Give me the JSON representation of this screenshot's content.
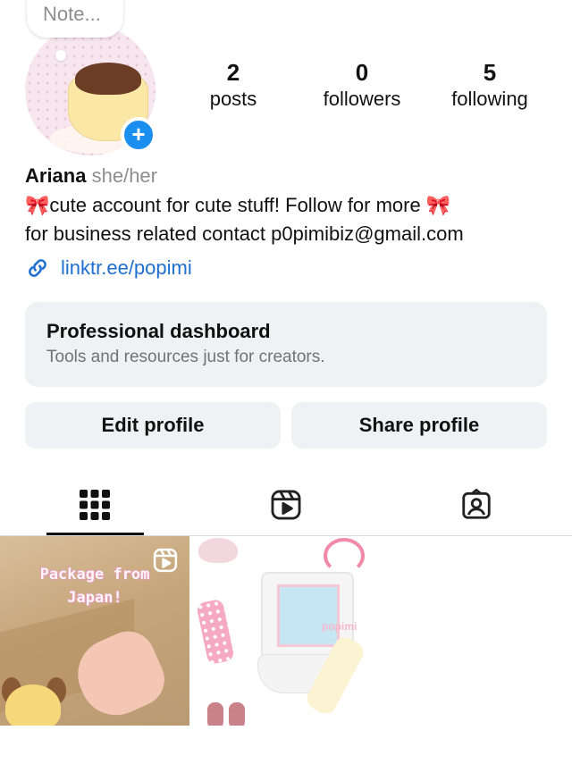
{
  "profile": {
    "note_placeholder": "Note...",
    "add_icon": "plus-icon",
    "avatar_icon": "pudding-avatar"
  },
  "stats": [
    {
      "value": "2",
      "label": "posts"
    },
    {
      "value": "0",
      "label": "followers"
    },
    {
      "value": "5",
      "label": "following"
    }
  ],
  "bio": {
    "name": "Ariana",
    "pronouns": "she/her",
    "line1": "🎀cute account for cute stuff! Follow for more 🎀",
    "line2": "for business related contact p0pimibiz@gmail.com",
    "link": "linktr.ee/popimi",
    "link_icon": "link-icon"
  },
  "dashboard": {
    "title": "Professional dashboard",
    "subtitle": "Tools and resources just for creators."
  },
  "buttons": {
    "edit": "Edit profile",
    "share": "Share profile"
  },
  "tabs": [
    {
      "icon": "grid-icon",
      "active": true
    },
    {
      "icon": "reels-icon",
      "active": false
    },
    {
      "icon": "tagged-icon",
      "active": false
    }
  ],
  "posts": [
    {
      "caption": "Package from Japan!",
      "type": "reel"
    },
    {
      "watermark": "popimi",
      "type": "photo"
    }
  ],
  "colors": {
    "accent": "#1a8ff0",
    "link": "#1f6fd1",
    "button_bg": "#eff1f4",
    "secondary_text": "#737373"
  }
}
